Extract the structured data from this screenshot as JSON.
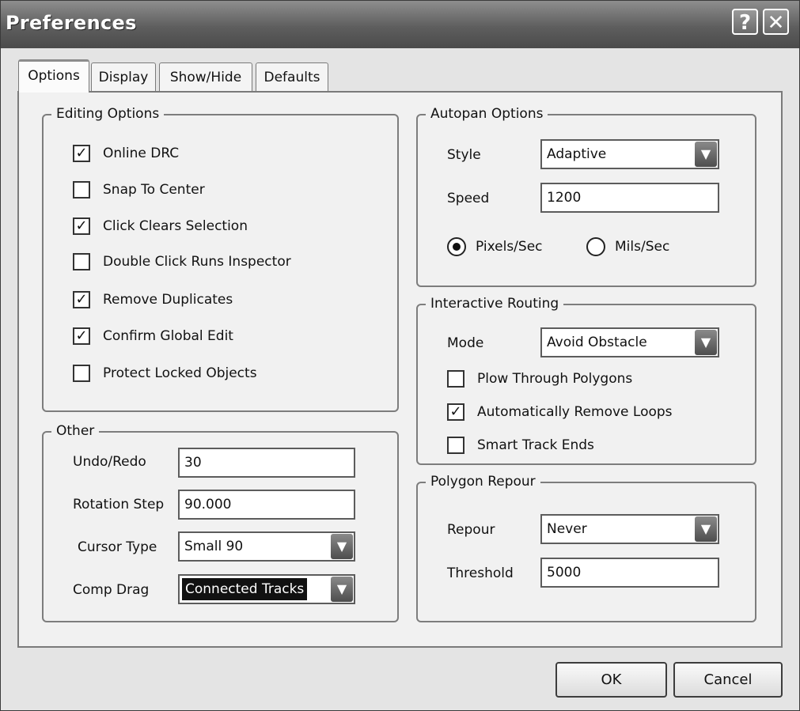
{
  "window": {
    "title": "Preferences",
    "help_glyph": "?",
    "close_glyph": "✕"
  },
  "tabs": [
    {
      "label": "Options",
      "active": true
    },
    {
      "label": "Display",
      "active": false
    },
    {
      "label": "Show/Hide",
      "active": false
    },
    {
      "label": "Defaults",
      "active": false
    }
  ],
  "editing": {
    "legend": "Editing Options",
    "items": [
      {
        "label": "Online DRC",
        "checked": true,
        "mark": "✓"
      },
      {
        "label": "Snap To Center",
        "checked": false,
        "mark": ""
      },
      {
        "label": "Click Clears Selection",
        "checked": true,
        "mark": "✓"
      },
      {
        "label": "Double Click Runs Inspector",
        "checked": false,
        "mark": ""
      },
      {
        "label": "Remove Duplicates",
        "checked": true,
        "mark": "✓"
      },
      {
        "label": "Confirm Global Edit",
        "checked": true,
        "mark": "✓"
      },
      {
        "label": "Protect Locked Objects",
        "checked": false,
        "mark": ""
      }
    ]
  },
  "other": {
    "legend": "Other",
    "undo_label": "Undo/Redo",
    "undo_value": "30",
    "rotation_label": "Rotation Step",
    "rotation_value": "90.000",
    "cursor_label": "Cursor Type",
    "cursor_value": "Small 90",
    "drag_label": "Comp Drag",
    "drag_value": "Connected Tracks"
  },
  "autopan": {
    "legend": "Autopan Options",
    "style_label": "Style",
    "style_value": "Adaptive",
    "speed_label": "Speed",
    "speed_value": "1200",
    "unit_options": [
      {
        "label": "Pixels/Sec",
        "selected": true
      },
      {
        "label": "Mils/Sec",
        "selected": false
      }
    ]
  },
  "routing": {
    "legend": "Interactive Routing",
    "mode_label": "Mode",
    "mode_value": "Avoid Obstacle",
    "items": [
      {
        "label": "Plow Through Polygons",
        "checked": false,
        "mark": ""
      },
      {
        "label": "Automatically Remove Loops",
        "checked": true,
        "mark": "✓"
      },
      {
        "label": "Smart Track Ends",
        "checked": false,
        "mark": ""
      }
    ]
  },
  "repour": {
    "legend": "Polygon Repour",
    "repour_label": "Repour",
    "repour_value": "Never",
    "threshold_label": "Threshold",
    "threshold_value": "5000"
  },
  "buttons": {
    "ok": "OK",
    "cancel": "Cancel"
  },
  "icons": {
    "dropdown_arrow": "▼"
  },
  "colors": {
    "titlebar": "#5e5e5e",
    "page": "#f1f1f1",
    "window": "#e4e4e4"
  }
}
